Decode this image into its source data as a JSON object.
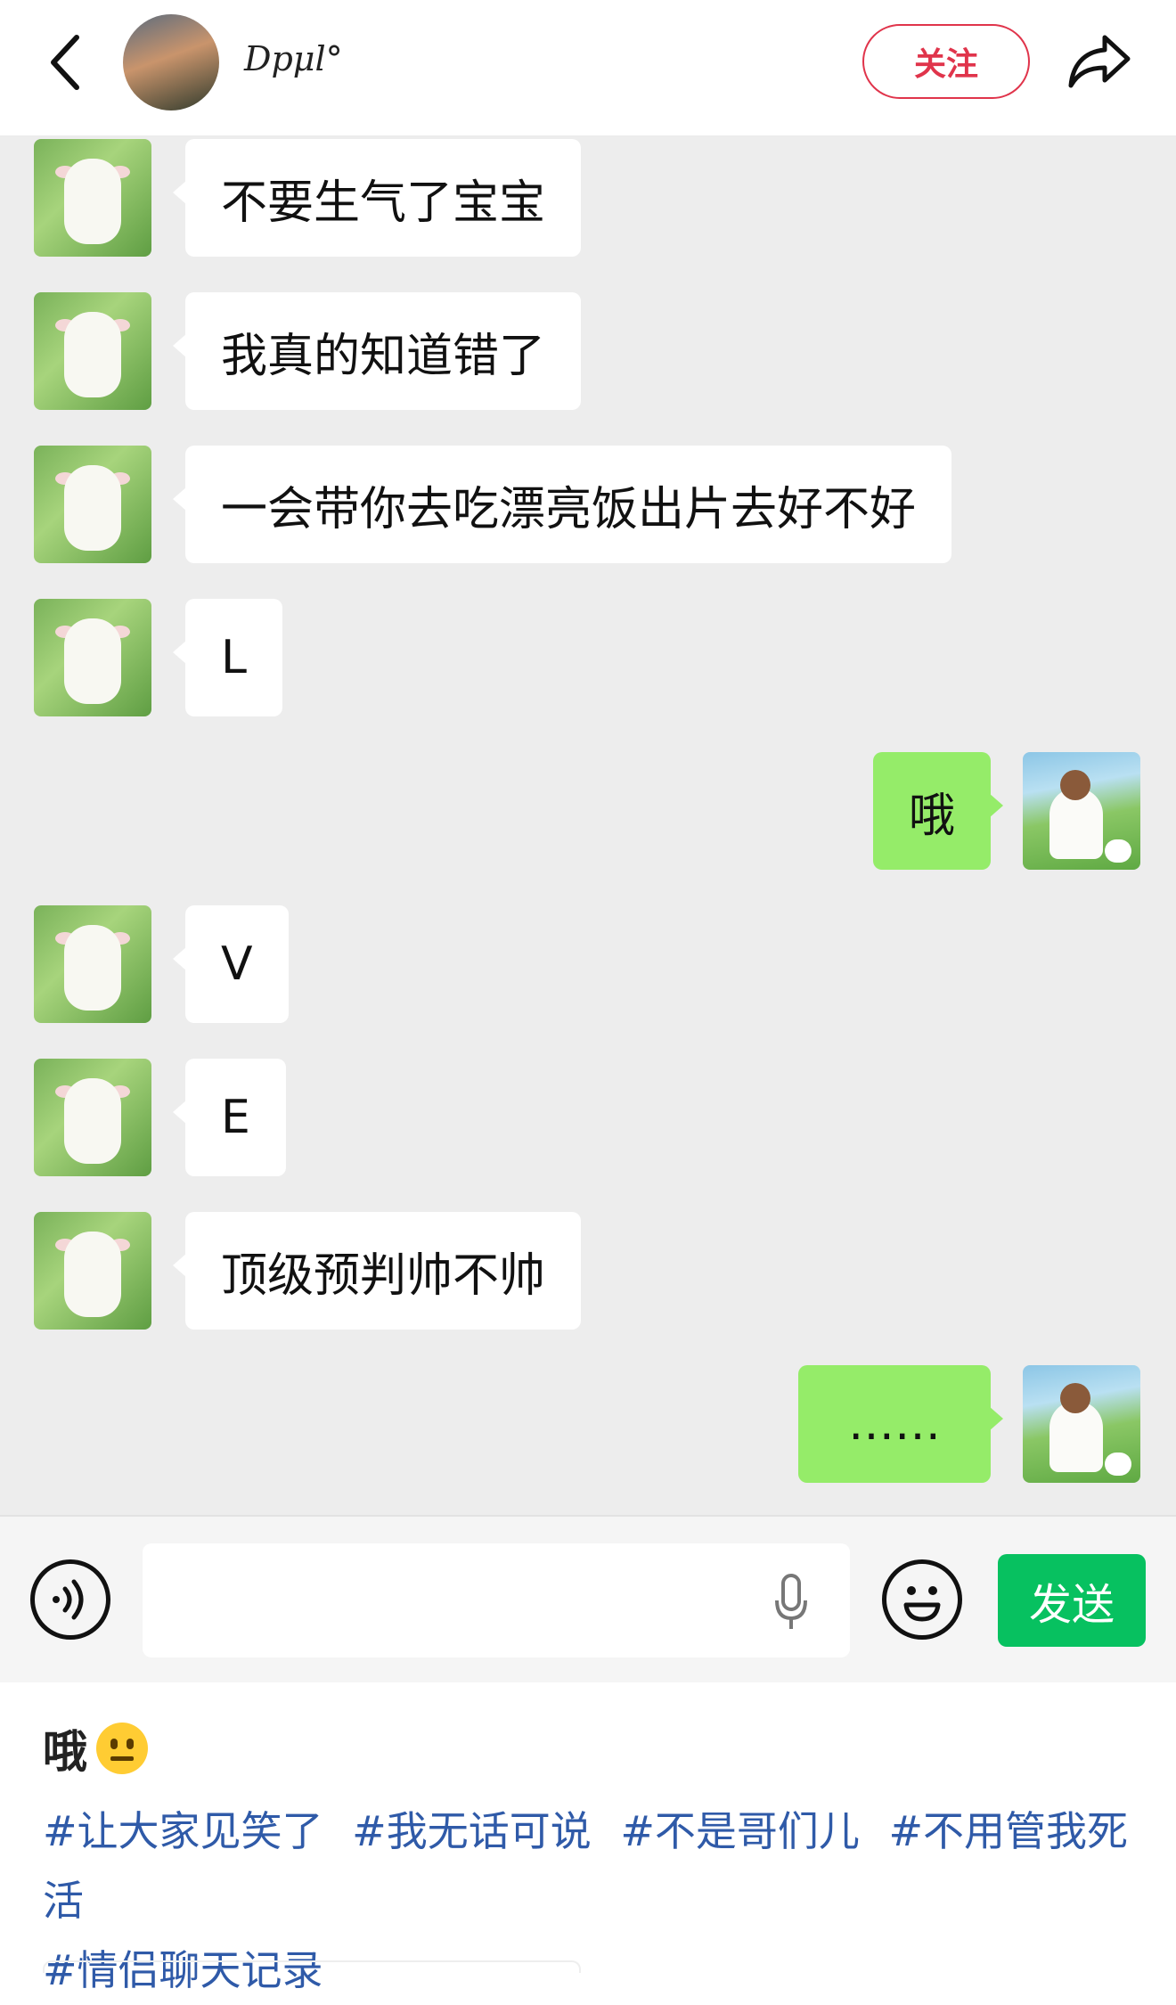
{
  "header": {
    "username": "Dpμl°",
    "follow_label": "关注",
    "icons": {
      "back": "chevron-left-icon",
      "share": "share-arrow-icon"
    }
  },
  "messages": [
    {
      "side": "left",
      "text": "不要生气了宝宝"
    },
    {
      "side": "left",
      "text": "我真的知道错了"
    },
    {
      "side": "left",
      "text": "一会带你去吃漂亮饭出片去好不好"
    },
    {
      "side": "left",
      "text": "L"
    },
    {
      "side": "right",
      "text": "哦"
    },
    {
      "side": "left",
      "text": "V"
    },
    {
      "side": "left",
      "text": "E"
    },
    {
      "side": "left",
      "text": "顶级预判帅不帅"
    },
    {
      "side": "right",
      "text": "……"
    }
  ],
  "input_bar": {
    "placeholder": "",
    "send_label": "发送",
    "icons": {
      "voice": "voice-icon",
      "mic": "microphone-icon",
      "emoji": "smiley-icon"
    }
  },
  "post": {
    "title": "哦",
    "title_emoji": "neutral-face-emoji",
    "tags": [
      "#让大家见笑了",
      "#我无话可说",
      "#不是哥们儿",
      "#不用管我死活",
      "#情侣聊天记录"
    ]
  },
  "colors": {
    "accent_red": "#e0344b",
    "bubble_green": "#95ec69",
    "send_green": "#07c160",
    "tag_blue": "#2f5aa8"
  }
}
